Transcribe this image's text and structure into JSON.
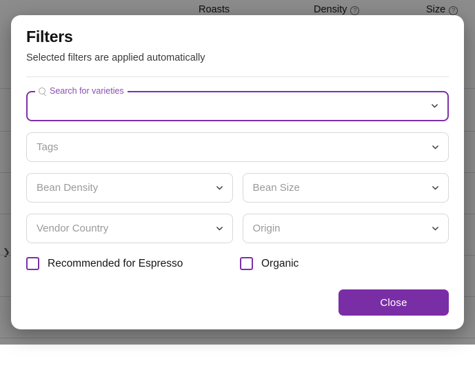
{
  "background": {
    "columns": [
      {
        "label": "Roasts",
        "has_help_icon": false
      },
      {
        "label": "Density",
        "has_help_icon": true
      },
      {
        "label": "Size",
        "has_help_icon": true
      }
    ],
    "row_divider_count": 7
  },
  "dialog": {
    "title": "Filters",
    "subtitle": "Selected filters are applied automatically",
    "search": {
      "label": "Search for varieties",
      "value": "",
      "placeholder": "",
      "focused": true,
      "icon": "search-icon",
      "dropdown_icon": "chevron-down-icon"
    },
    "selects": [
      {
        "name": "tags",
        "placeholder": "Tags",
        "value": "",
        "icon": "chevron-down-icon"
      },
      {
        "name": "bean-density",
        "placeholder": "Bean Density",
        "value": "",
        "icon": "chevron-down-icon"
      },
      {
        "name": "bean-size",
        "placeholder": "Bean Size",
        "value": "",
        "icon": "chevron-down-icon"
      },
      {
        "name": "vendor-country",
        "placeholder": "Vendor Country",
        "value": "",
        "icon": "chevron-down-icon"
      },
      {
        "name": "origin",
        "placeholder": "Origin",
        "value": "",
        "icon": "chevron-down-icon"
      }
    ],
    "checkboxes": [
      {
        "name": "recommended-for-espresso",
        "label": "Recommended for Espresso",
        "checked": false
      },
      {
        "name": "organic",
        "label": "Organic",
        "checked": false
      }
    ],
    "close_label": "Close"
  },
  "colors": {
    "accent": "#7e30a8",
    "accent_button": "#7a2ea6",
    "label_purple": "#8b4fae",
    "placeholder": "#9a9a9a",
    "border": "#d8d8d8",
    "scrim": "rgba(0,0,0,0.45)"
  }
}
